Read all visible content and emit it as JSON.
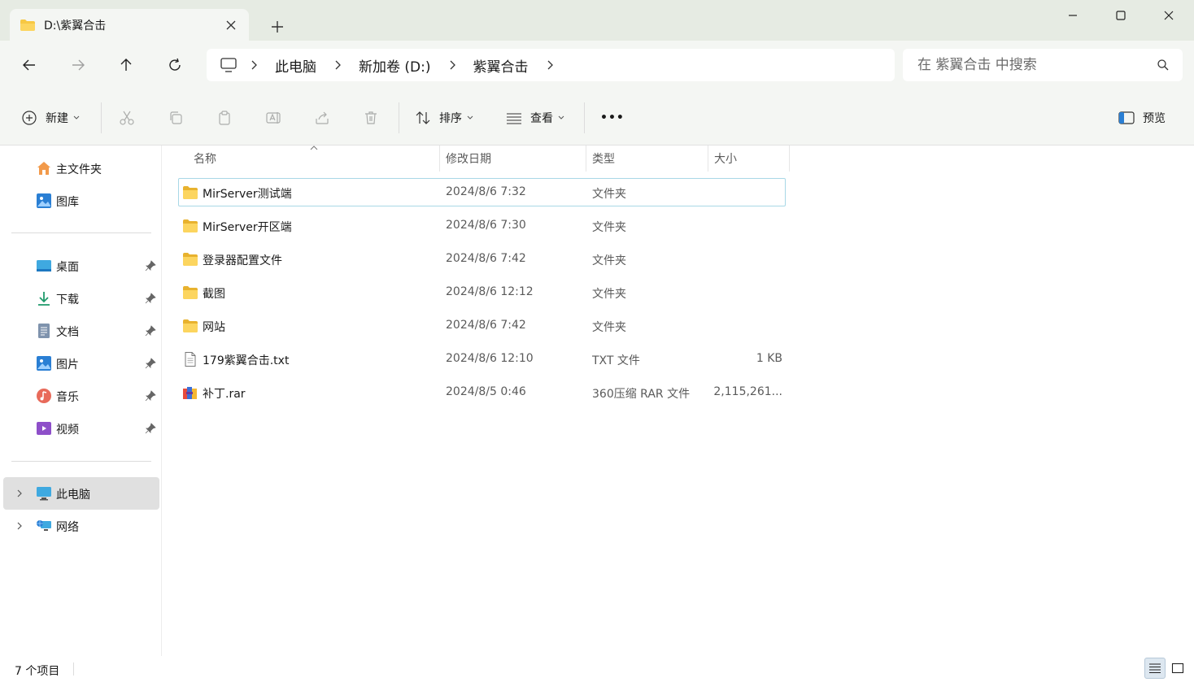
{
  "window": {
    "tab_title": "D:\\紫翼合击",
    "colors": {
      "titlebar": "#e6ebe3",
      "toolbar": "#f4f6f3",
      "folder": "#f7c843",
      "selection_border": "#a8d8e6"
    }
  },
  "address_bar": {
    "breadcrumbs": [
      "此电脑",
      "新加卷 (D:)",
      "紫翼合击"
    ],
    "search_placeholder": "在 紫翼合击 中搜索"
  },
  "toolbar": {
    "new_label": "新建",
    "sort_label": "排序",
    "view_label": "查看",
    "more_label": "•••",
    "preview_label": "预览",
    "icons": [
      "cut-icon",
      "copy-icon",
      "paste-icon",
      "rename-icon",
      "share-icon",
      "delete-icon"
    ]
  },
  "sidebar": {
    "quick": [
      {
        "label": "主文件夹",
        "icon": "home-icon"
      },
      {
        "label": "图库",
        "icon": "gallery-icon"
      }
    ],
    "pinned": [
      {
        "label": "桌面",
        "icon": "desktop-icon"
      },
      {
        "label": "下载",
        "icon": "download-icon"
      },
      {
        "label": "文档",
        "icon": "document-icon"
      },
      {
        "label": "图片",
        "icon": "pictures-icon"
      },
      {
        "label": "音乐",
        "icon": "music-icon"
      },
      {
        "label": "视频",
        "icon": "video-icon"
      }
    ],
    "locations": [
      {
        "label": "此电脑",
        "icon": "computer-icon",
        "selected": true
      },
      {
        "label": "网络",
        "icon": "network-icon",
        "selected": false
      }
    ]
  },
  "file_list": {
    "columns": [
      "名称",
      "修改日期",
      "类型",
      "大小"
    ],
    "rows": [
      {
        "name": "MirServer测试端",
        "date": "2024/8/6 7:32",
        "type": "文件夹",
        "size": "",
        "icon": "folder-icon"
      },
      {
        "name": "MirServer开区端",
        "date": "2024/8/6 7:30",
        "type": "文件夹",
        "size": "",
        "icon": "folder-icon"
      },
      {
        "name": "登录器配置文件",
        "date": "2024/8/6 7:42",
        "type": "文件夹",
        "size": "",
        "icon": "folder-icon"
      },
      {
        "name": "截图",
        "date": "2024/8/6 12:12",
        "type": "文件夹",
        "size": "",
        "icon": "folder-icon"
      },
      {
        "name": "网站",
        "date": "2024/8/6 7:42",
        "type": "文件夹",
        "size": "",
        "icon": "folder-icon"
      },
      {
        "name": "179紫翼合击.txt",
        "date": "2024/8/6 12:10",
        "type": "TXT 文件",
        "size": "1 KB",
        "icon": "text-file-icon"
      },
      {
        "name": "补丁.rar",
        "date": "2024/8/5 0:46",
        "type": "360压缩 RAR 文件",
        "size": "2,115,261...",
        "icon": "rar-archive-icon"
      }
    ]
  },
  "status_bar": {
    "item_count": "7 个项目"
  }
}
